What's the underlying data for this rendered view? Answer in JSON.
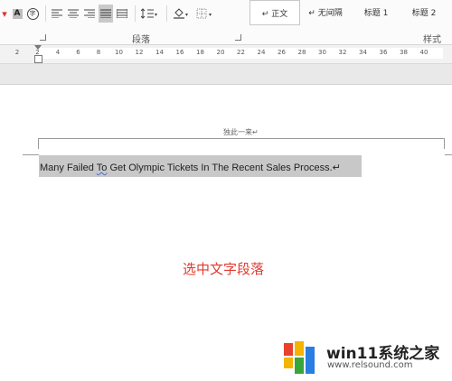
{
  "toolbar": {
    "font_color_a": "A",
    "char_border_a": "A",
    "enclose_char": "字",
    "align_icons": [
      "align-left-icon",
      "align-center-icon",
      "align-right-icon",
      "justify-icon",
      "distributed-icon"
    ],
    "line_spacing_icon": "line-spacing-icon",
    "shading_icon": "paint-bucket-icon",
    "border_icon": "border-icon"
  },
  "groups": {
    "paragraph_label": "段落",
    "styles_label": "样式"
  },
  "styles": [
    {
      "label": "↵ 正文",
      "active": true
    },
    {
      "label": "↵ 无间隔",
      "active": false
    },
    {
      "label": "标题 1",
      "active": false
    },
    {
      "label": "标题 2",
      "active": false
    }
  ],
  "ruler": {
    "ticks": [
      "2",
      "2",
      "4",
      "6",
      "8",
      "10",
      "12",
      "14",
      "16",
      "18",
      "20",
      "22",
      "24",
      "26",
      "28",
      "30",
      "32",
      "34",
      "36",
      "38",
      "40"
    ]
  },
  "document": {
    "header_text": "独此一来↵",
    "selected_text_prefix": "Many Failed ",
    "selected_text_word": "To",
    "selected_text_suffix": " Get Olympic Tickets In The Recent Sales Process.↵",
    "caption": "选中文字段落"
  },
  "watermark": {
    "title": "win11系统之家",
    "url": "www.relsound.com",
    "colors": {
      "red": "#e8412c",
      "yellow": "#f4b400",
      "green": "#3aa53a",
      "blue": "#2a7de1"
    }
  },
  "colors": {
    "caption": "#e03a2f",
    "selection": "#c8c8c8"
  }
}
